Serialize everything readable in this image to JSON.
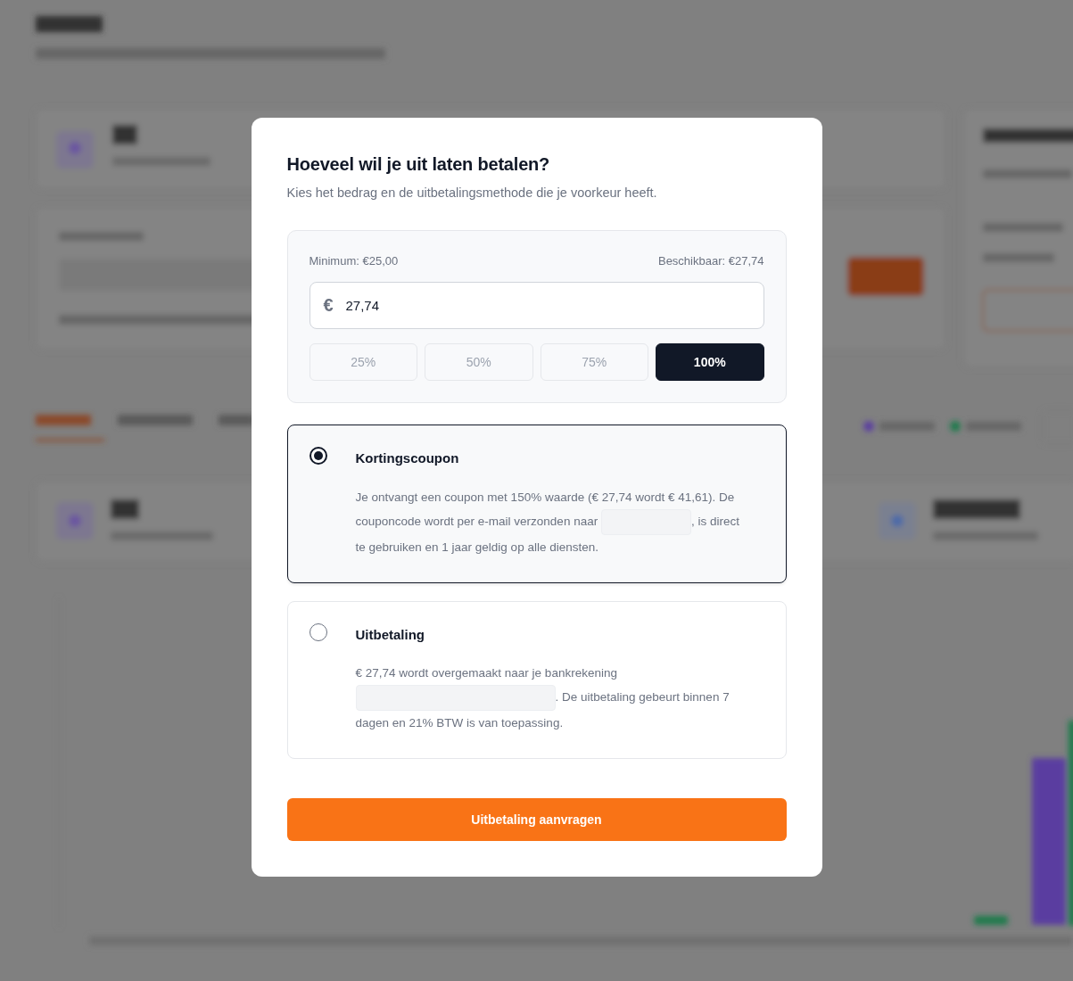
{
  "modal": {
    "title": "Hoeveel wil je uit laten betalen?",
    "subtitle": "Kies het bedrag en de uitbetalingsmethode die je voorkeur heeft.",
    "amount": {
      "minimum": "Minimum: €25,00",
      "available": "Beschikbaar: €27,74",
      "currency": "€",
      "value": "27,74",
      "presets": [
        {
          "label": "25%",
          "selected": false
        },
        {
          "label": "50%",
          "selected": false
        },
        {
          "label": "75%",
          "selected": false
        },
        {
          "label": "100%",
          "selected": true
        }
      ]
    },
    "methods": [
      {
        "title": "Kortingscoupon",
        "selected": true,
        "segments": [
          {
            "kind": "text",
            "text": "Je ontvangt een coupon met 150% waarde (€ 27,74 wordt € 41,61). De couponcode wordt per e-mail verzonden naar"
          },
          {
            "kind": "redacted_short"
          },
          {
            "kind": "text",
            "text": ", is direct te gebruiken en 1 jaar geldig op alle diensten."
          }
        ]
      },
      {
        "title": "Uitbetaling",
        "selected": false,
        "segments": [
          {
            "kind": "text",
            "text": "€ 27,74 wordt overgemaakt naar je bankrekening"
          },
          {
            "kind": "redacted_long"
          },
          {
            "kind": "text",
            "text": ". De uitbetaling gebeurt binnen 7 dagen en 21% BTW is van toepassing."
          }
        ]
      }
    ],
    "submit": "Uitbetaling aanvragen"
  }
}
